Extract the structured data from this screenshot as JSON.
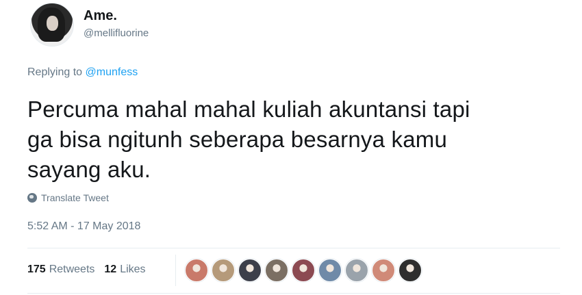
{
  "author": {
    "display_name": "Ame.",
    "handle": "@mellifluorine"
  },
  "reply": {
    "prefix": "Replying to",
    "mention": "@munfess"
  },
  "tweet": {
    "text_line1": "Percuma mahal mahal kuliah akuntansi tapi",
    "text_line2": "ga bisa ngitunh seberapa besarnya kamu",
    "text_line3": "sayang aku.",
    "translate_label": "Translate Tweet",
    "timestamp": "5:52 AM - 17 May 2018"
  },
  "stats": {
    "retweets_count": "175",
    "retweets_label": "Retweets",
    "likes_count": "12",
    "likes_label": "Likes"
  },
  "likers": [
    {
      "color": "#c97a6a"
    },
    {
      "color": "#b59a7a"
    },
    {
      "color": "#3c3f4a"
    },
    {
      "color": "#7b6f63"
    },
    {
      "color": "#8c4a52"
    },
    {
      "color": "#6f8aa8"
    },
    {
      "color": "#9aa3ab"
    },
    {
      "color": "#d08a78"
    },
    {
      "color": "#2e2e2e"
    }
  ],
  "colors": {
    "link": "#1da1f2",
    "secondary_text": "#657786",
    "primary_text": "#14171a",
    "border": "#e6ecf0"
  }
}
